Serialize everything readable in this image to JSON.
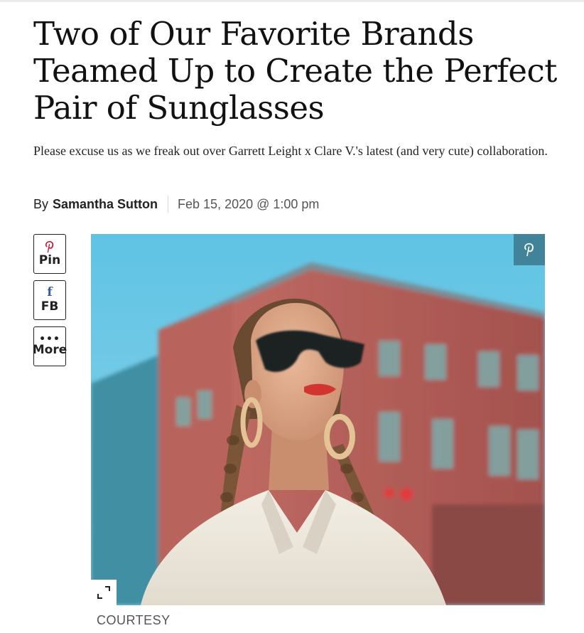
{
  "article": {
    "headline": "Two of Our Favorite Brands Teamed Up to Create the Perfect Pair of Sunglasses",
    "dek": "Please excuse us as we freak out over Garrett Leight x Clare V.'s latest (and very cute) collaboration.",
    "byline": {
      "prefix": "By",
      "author": "Samantha Sutton",
      "date": "Feb 15, 2020 @ 1:00 pm"
    }
  },
  "share": {
    "pin_label": "Pin",
    "fb_label": "FB",
    "fb_icon_glyph": "f",
    "more_label": "More",
    "more_icon_glyph": "•••"
  },
  "image": {
    "alt": "Woman with braided hair wearing dark cat-eye sunglasses and hoop earrings in front of a pink building",
    "credit": "COURTESY"
  },
  "colors": {
    "pinterest_red": "#c8102e",
    "facebook_blue": "#3b5998",
    "pin_overlay": "#3c788c"
  }
}
